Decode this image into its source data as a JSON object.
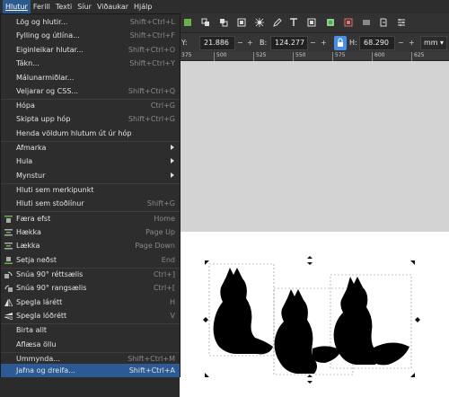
{
  "menubar": {
    "items": [
      "Hlutur",
      "Ferill",
      "Texti",
      "Síur",
      "Viðaukar",
      "Hjálp"
    ]
  },
  "controls": {
    "y_label": "Y:",
    "y_value": "21.886",
    "w_label": "B:",
    "w_value": "124.277",
    "h_label": "H:",
    "h_value": "68.290",
    "units": "mm"
  },
  "ruler": {
    "ticks": [
      "375",
      "500",
      "525",
      "550",
      "575",
      "600",
      "625"
    ]
  },
  "menu": {
    "items": [
      {
        "label": "Lög og hlutir...",
        "shortcut": "Shift+Ctrl+L"
      },
      {
        "label": "Fylling og útlína...",
        "shortcut": "Shift+Ctrl+F"
      },
      {
        "label": "Eiginleikar hlutar...",
        "shortcut": "Shift+Ctrl+O"
      },
      {
        "label": "Tákn...",
        "shortcut": "Shift+Ctrl+Y"
      },
      {
        "label": "Málunarmiðlar...",
        "shortcut": ""
      },
      {
        "label": "Veljarar og CSS...",
        "shortcut": "Shift+Ctrl+Q"
      },
      {
        "label": "Hópa",
        "shortcut": "Ctrl+G"
      },
      {
        "label": "Skipta upp hóp",
        "shortcut": "Shift+Ctrl+G"
      },
      {
        "label": "Henda völdum hlutum út úr hóp",
        "shortcut": ""
      },
      {
        "label": "Afmarka",
        "shortcut": ""
      },
      {
        "label": "Hula",
        "shortcut": ""
      },
      {
        "label": "Mynstur",
        "shortcut": ""
      },
      {
        "label": "Hluti sem merkipunkt",
        "shortcut": ""
      },
      {
        "label": "Hluti sem stoðlínur",
        "shortcut": "Shift+G"
      },
      {
        "label": "Færa efst",
        "shortcut": "Home"
      },
      {
        "label": "Hækka",
        "shortcut": "Page Up"
      },
      {
        "label": "Lækka",
        "shortcut": "Page Down"
      },
      {
        "label": "Setja neðst",
        "shortcut": "End"
      },
      {
        "label": "Snúa 90° réttsælis",
        "shortcut": "Ctrl+]"
      },
      {
        "label": "Snúa 90° rangsælis",
        "shortcut": "Ctrl+["
      },
      {
        "label": "Spegla lárétt",
        "shortcut": "H"
      },
      {
        "label": "Spegla lóðrétt",
        "shortcut": "V"
      },
      {
        "label": "Birta allt",
        "shortcut": ""
      },
      {
        "label": "Aflæsa öllu",
        "shortcut": ""
      },
      {
        "label": "Ummynda...",
        "shortcut": "Shift+Ctrl+M"
      },
      {
        "label": "Jafna og dreifa...",
        "shortcut": "Shift+Ctrl+A"
      }
    ]
  },
  "colors": {
    "menu_bg": "#2d2d2d",
    "highlight": "#2c5a94",
    "canvas_gray": "#d3d3d3",
    "page": "#ffffff",
    "fox": "#000000"
  }
}
